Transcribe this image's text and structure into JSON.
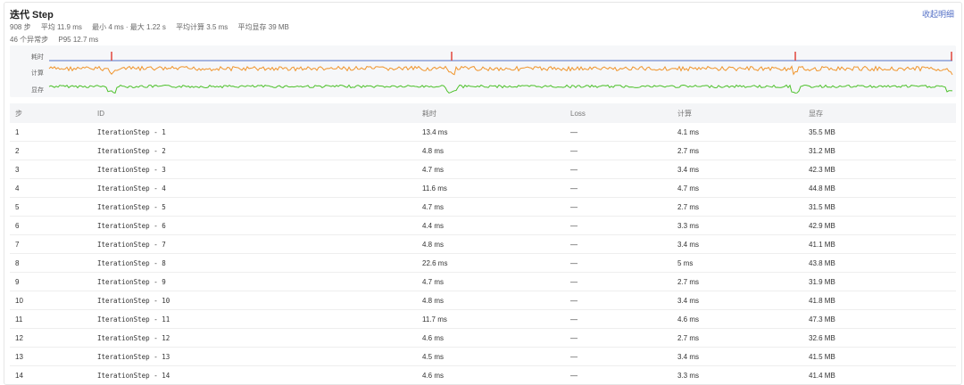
{
  "header": {
    "title": "迭代 Step",
    "collapse_label": "收起明细",
    "stats": [
      "908 步",
      "平均 11.9 ms",
      "最小 4 ms · 最大 1.22 s",
      "平均计算 3.5 ms",
      "平均显存 39 MB"
    ],
    "sub_stats": [
      "46 个异常步",
      "P95 12.7 ms"
    ]
  },
  "sparklines": {
    "labels": {
      "duration": "耗时",
      "compute": "计算",
      "memory": "显存"
    },
    "colors": {
      "duration": "#5470c6",
      "spike": "#e03a2f",
      "compute": "#f0942a",
      "memory": "#4cc12a"
    }
  },
  "table": {
    "columns": [
      "步",
      "ID",
      "耗时",
      "Loss",
      "计算",
      "显存"
    ],
    "rows": [
      [
        "1",
        "IterationStep - 1",
        "13.4 ms",
        "—",
        "4.1 ms",
        "35.5 MB"
      ],
      [
        "2",
        "IterationStep - 2",
        "4.8 ms",
        "—",
        "2.7 ms",
        "31.2 MB"
      ],
      [
        "3",
        "IterationStep - 3",
        "4.7 ms",
        "—",
        "3.4 ms",
        "42.3 MB"
      ],
      [
        "4",
        "IterationStep - 4",
        "11.6 ms",
        "—",
        "4.7 ms",
        "44.8 MB"
      ],
      [
        "5",
        "IterationStep - 5",
        "4.7 ms",
        "—",
        "2.7 ms",
        "31.5 MB"
      ],
      [
        "6",
        "IterationStep - 6",
        "4.4 ms",
        "—",
        "3.3 ms",
        "42.9 MB"
      ],
      [
        "7",
        "IterationStep - 7",
        "4.8 ms",
        "—",
        "3.4 ms",
        "41.1 MB"
      ],
      [
        "8",
        "IterationStep - 8",
        "22.6 ms",
        "—",
        "5 ms",
        "43.8 MB"
      ],
      [
        "9",
        "IterationStep - 9",
        "4.7 ms",
        "—",
        "2.7 ms",
        "31.9 MB"
      ],
      [
        "10",
        "IterationStep - 10",
        "4.8 ms",
        "—",
        "3.4 ms",
        "41.8 MB"
      ],
      [
        "11",
        "IterationStep - 11",
        "11.7 ms",
        "—",
        "4.6 ms",
        "47.3 MB"
      ],
      [
        "12",
        "IterationStep - 12",
        "4.6 ms",
        "—",
        "2.7 ms",
        "32.6 MB"
      ],
      [
        "13",
        "IterationStep - 13",
        "4.5 ms",
        "—",
        "3.4 ms",
        "41.5 MB"
      ],
      [
        "14",
        "IterationStep - 14",
        "4.6 ms",
        "—",
        "3.3 ms",
        "41.4 MB"
      ]
    ]
  }
}
